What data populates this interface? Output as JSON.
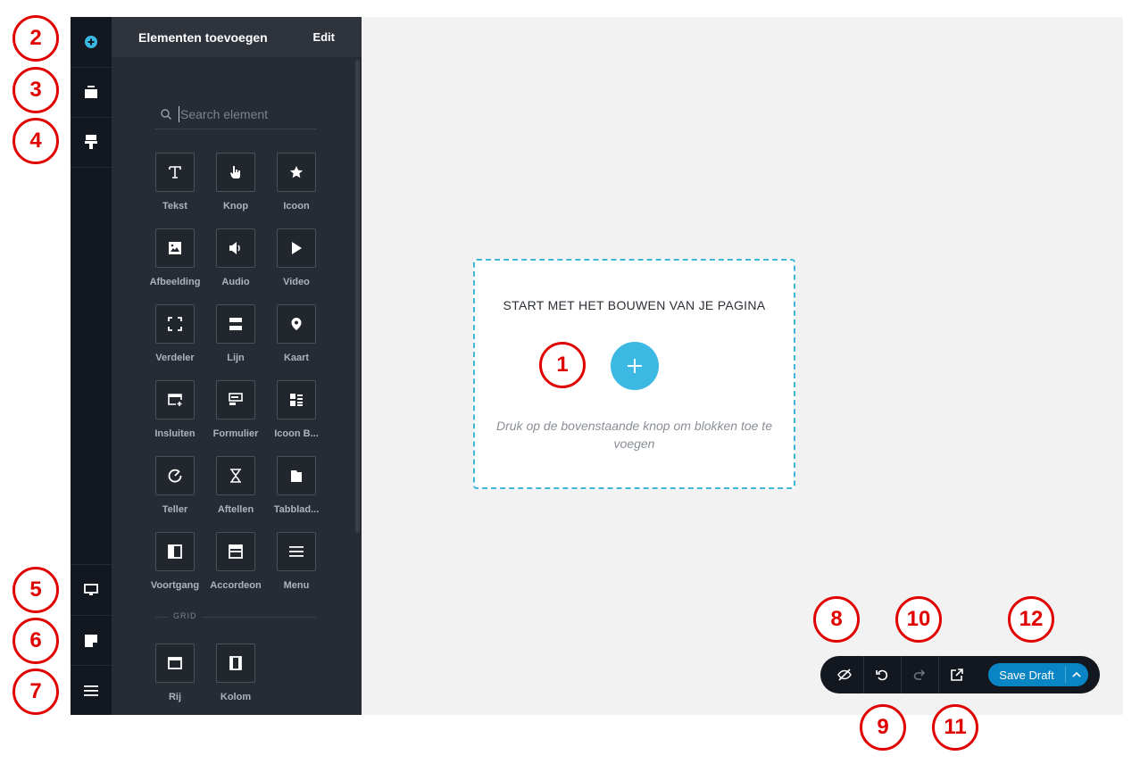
{
  "sidebar_rail": {
    "top_items": [
      {
        "name": "add-elements",
        "icon": "plus-circle-icon"
      },
      {
        "name": "sections",
        "icon": "section-icon"
      },
      {
        "name": "blocks",
        "icon": "paint-roller-icon"
      }
    ],
    "bottom_items": [
      {
        "name": "device-preview",
        "icon": "monitor-icon"
      },
      {
        "name": "pages",
        "icon": "page-icon"
      },
      {
        "name": "menu",
        "icon": "hamburger-icon"
      }
    ]
  },
  "panel": {
    "title": "Elementen toevoegen",
    "edit_label": "Edit",
    "search": {
      "placeholder": "Search element",
      "value": ""
    },
    "elements": [
      {
        "label": "Tekst",
        "icon": "text-icon"
      },
      {
        "label": "Knop",
        "icon": "pointer-hand-icon"
      },
      {
        "label": "Icoon",
        "icon": "star-icon"
      },
      {
        "label": "Afbeelding",
        "icon": "image-icon"
      },
      {
        "label": "Audio",
        "icon": "speaker-icon"
      },
      {
        "label": "Video",
        "icon": "play-icon"
      },
      {
        "label": "Verdeler",
        "icon": "divider-icon"
      },
      {
        "label": "Lijn",
        "icon": "line-icon"
      },
      {
        "label": "Kaart",
        "icon": "map-pin-icon"
      },
      {
        "label": "Insluiten",
        "icon": "embed-icon"
      },
      {
        "label": "Formulier",
        "icon": "form-icon"
      },
      {
        "label": "Icoon B...",
        "icon": "icon-box-icon"
      },
      {
        "label": "Teller",
        "icon": "counter-icon"
      },
      {
        "label": "Aftellen",
        "icon": "hourglass-icon"
      },
      {
        "label": "Tabblad...",
        "icon": "tabs-icon"
      },
      {
        "label": "Voortgang",
        "icon": "progress-icon"
      },
      {
        "label": "Accordeon",
        "icon": "accordion-icon"
      },
      {
        "label": "Menu",
        "icon": "menu-icon"
      }
    ],
    "grid_heading": "GRID",
    "grid_elements": [
      {
        "label": "Rij",
        "icon": "row-icon"
      },
      {
        "label": "Kolom",
        "icon": "column-icon"
      }
    ]
  },
  "canvas": {
    "title": "START MET HET BOUWEN VAN JE PAGINA",
    "hint": "Druk op de bovenstaande knop om blokken toe te voegen"
  },
  "toolbar": {
    "items": [
      "hide-icon",
      "undo-icon",
      "redo-icon",
      "external-link-icon"
    ],
    "save_label": "Save Draft"
  },
  "annotations": [
    "1",
    "2",
    "3",
    "4",
    "5",
    "6",
    "7",
    "8",
    "9",
    "10",
    "11",
    "12"
  ],
  "colors": {
    "accent": "#3bb9e2",
    "save": "#0a85c3",
    "marker": "#e00000",
    "rail": "#13171f",
    "panel": "#272b33"
  }
}
